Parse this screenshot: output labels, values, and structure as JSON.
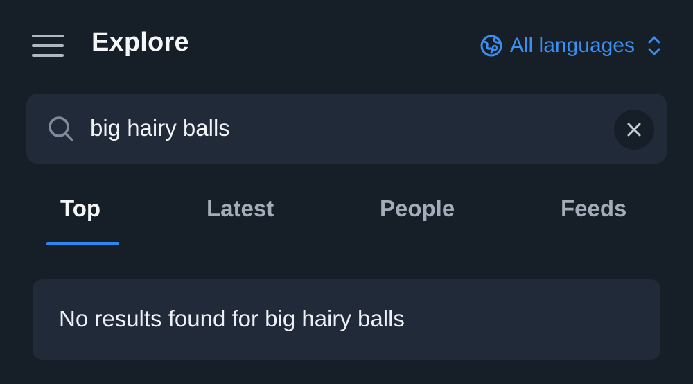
{
  "header": {
    "title": "Explore",
    "language_label": "All languages"
  },
  "search": {
    "query": "big hairy balls"
  },
  "tabs": [
    {
      "label": "Top",
      "active": true
    },
    {
      "label": "Latest",
      "active": false
    },
    {
      "label": "People",
      "active": false
    },
    {
      "label": "Feeds",
      "active": false
    }
  ],
  "results": {
    "empty_message": "No results found for big hairy balls"
  },
  "colors": {
    "background": "#161e27",
    "surface": "#202a39",
    "accent": "#2f86ee",
    "link": "#3c8ef0",
    "muted_text": "#a3acb8"
  },
  "icons": {
    "menu": "hamburger-menu-icon",
    "language": "globe-icon",
    "language_chevron": "chevron-up-down-icon",
    "search": "search-icon",
    "clear": "close-icon"
  }
}
